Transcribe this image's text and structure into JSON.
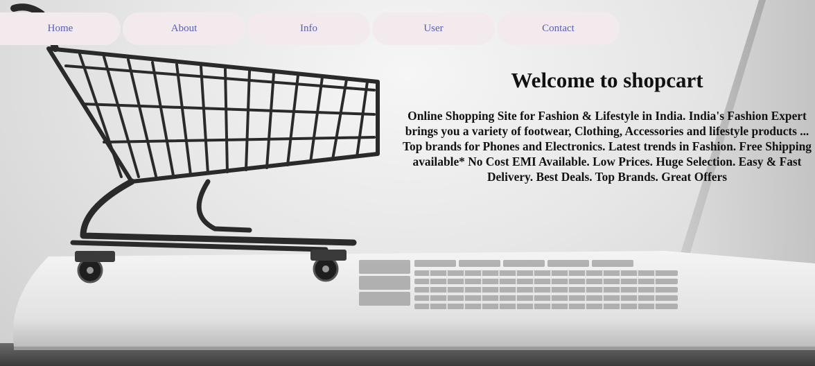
{
  "nav": {
    "items": [
      {
        "label": "Home"
      },
      {
        "label": "About"
      },
      {
        "label": "Info"
      },
      {
        "label": "User"
      },
      {
        "label": "Contact"
      }
    ]
  },
  "hero": {
    "title": "Welcome to shopcart",
    "description": "Online Shopping Site for Fashion & Lifestyle in India. India's Fashion Expert brings you a variety of footwear, Clothing, Accessories and lifestyle products ... Top brands for Phones and Electronics. Latest trends in Fashion. Free Shipping available* No Cost EMI Available. Low Prices. Huge Selection. Easy & Fast Delivery. Best Deals. Top Brands. Great Offers"
  },
  "background": {
    "image": "shopping-cart-on-laptop",
    "nav_pill_color": "#f2eaec",
    "nav_text_color": "#5a5db8"
  }
}
